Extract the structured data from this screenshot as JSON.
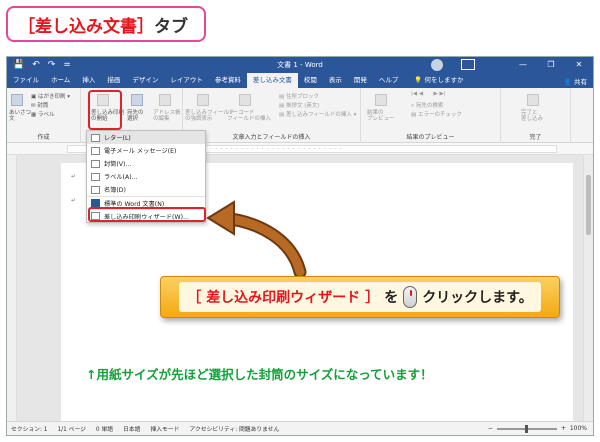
{
  "tag": {
    "prefix": "［",
    "title": "差し込み文書",
    "suffix": "］",
    "label": "タブ"
  },
  "window": {
    "title": "文書 1 - Word",
    "quick_access": [
      "💾",
      "↶",
      "↷",
      "="
    ],
    "controls": [
      "—",
      "❐",
      "✕"
    ],
    "tabs": [
      "ファイル",
      "ホーム",
      "挿入",
      "描画",
      "デザイン",
      "レイアウト",
      "参考資料",
      "差し込み文書",
      "校閲",
      "表示",
      "開発",
      "ヘルプ"
    ],
    "active_tab_index": 7,
    "tell_me": "何をしますか",
    "share": "共有"
  },
  "ribbon": {
    "create_group": {
      "label": "作成",
      "envelope": "はがき印刷",
      "envelopes": "封筒",
      "labels": "ラベル",
      "greeting": "あいさつ\n文"
    },
    "start_merge": "差し込み印刷\nの開始",
    "recipients": "宛先の\n選択",
    "edit_list": "アドレス帳\nの編集",
    "fields_group": {
      "label": "文章入力とフィールドの挿入",
      "highlight": "差し込みフィールド\nの強調表示",
      "barcode": "バーコード\nフィールドの挿入",
      "address_block": "住所ブロック",
      "greeting_line": "挨拶文 (英文)",
      "insert_field": "差し込みフィールドの挿入"
    },
    "preview_group": {
      "label": "結果のプレビュー",
      "preview": "結果の\nプレビュー",
      "find": "宛先の検索",
      "check": "エラーのチェック"
    },
    "finish_group": {
      "label": "完了",
      "finish": "完了と\n差し込み"
    }
  },
  "menu": {
    "items": [
      "レター(L)",
      "電子メール メッセージ(E)",
      "封筒(V)...",
      "ラベル(A)...",
      "名簿(D)",
      "標準の Word 文書(N)",
      "差し込み印刷ウィザード(W)..."
    ]
  },
  "status": {
    "section": "セクション: 1",
    "pages": "1/1 ページ",
    "words": "0 単語",
    "lang": "日本語",
    "mode": "挿入モード",
    "access": "アクセシビリティ: 問題ありません",
    "zoom": "100%"
  },
  "callout": {
    "open": "［",
    "target": "差し込み印刷ウィザード",
    "close": "］",
    "particle": "を",
    "action": "クリックします。"
  },
  "note": "↑用紙サイズが先ほど選択した封筒のサイズになっています！",
  "colors": {
    "accent": "#2b579a",
    "highlight": "#d9262c",
    "tag_border": "#e6479b",
    "note": "#15a13a",
    "callout": "#f5a913"
  }
}
